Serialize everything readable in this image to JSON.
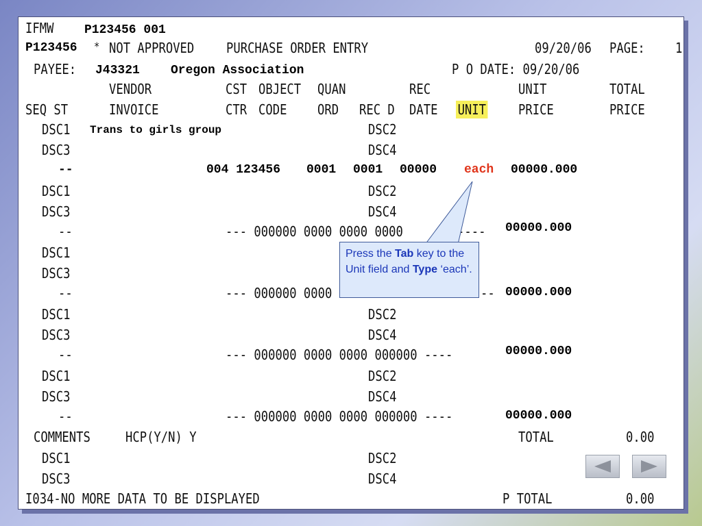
{
  "header": {
    "app_code": "IFMW",
    "session": "P123456 001",
    "user_id": "P123456",
    "star": "*",
    "status": "NOT APPROVED",
    "screen_title": "PURCHASE ORDER ENTRY",
    "date": "09/20/06",
    "page_label": "PAGE:",
    "page_number": "1"
  },
  "payee": {
    "label": "PAYEE:",
    "code": "J43321",
    "name": "Oregon Association",
    "po_date_label": "P O DATE: 09/20/06"
  },
  "columns": {
    "row1": {
      "vendor": "VENDOR",
      "cst": "CST",
      "object": "OBJECT",
      "quan": "QUAN",
      "rec": "REC",
      "unit_price": "UNIT",
      "total_price": "TOTAL"
    },
    "row2": {
      "seq_st": "SEQ ST",
      "invoice": "INVOICE",
      "ctr": "CTR",
      "code": "CODE",
      "ord": "ORD",
      "rec_d": "REC D",
      "date": "DATE",
      "unit": "UNIT",
      "price": "PRICE",
      "price2": "PRICE"
    }
  },
  "lines": [
    {
      "dsc1": "DSC1",
      "dsc1_text": "Trans to girls group",
      "dsc2": "DSC2",
      "dsc3": "DSC3",
      "dsc4": "DSC4",
      "seq": "--",
      "cst_obj": "004 123456",
      "quan": "0001",
      "rec": "0001",
      "date": "00000",
      "unit": "each",
      "price": "00000.000"
    },
    {
      "dsc1": "DSC1",
      "dsc2": "DSC2",
      "dsc3": "DSC3",
      "dsc4": "DSC4",
      "seq": "--",
      "data": "--- 000000 0000 0000 0000",
      "unit": "----",
      "price": "00000.000"
    },
    {
      "dsc1": "DSC1",
      "dsc3": "DSC3",
      "seq": "--",
      "data": "--- 000000 0000",
      "unit": "--",
      "price": "00000.000"
    },
    {
      "dsc1": "DSC1",
      "dsc2": "DSC2",
      "dsc3": "DSC3",
      "dsc4": "DSC4",
      "seq": "--",
      "data": "--- 000000 0000 0000 000000 ----",
      "price": "00000.000"
    },
    {
      "dsc1": "DSC1",
      "dsc2": "DSC2",
      "dsc3": "DSC3",
      "dsc4": "DSC4",
      "seq": "--",
      "data": "--- 000000 0000 0000 000000 ----",
      "price": "00000.000"
    }
  ],
  "footer": {
    "comments": "COMMENTS",
    "hcp": "HCP(Y/N) Y",
    "total_label": "TOTAL",
    "total_value": "0.00",
    "dsc1": "DSC1",
    "dsc2": "DSC2",
    "dsc3": "DSC3",
    "dsc4": "DSC4",
    "message": "I034-NO MORE DATA TO BE DISPLAYED",
    "p_total_label": "P TOTAL",
    "p_total_value": "0.00"
  },
  "callout": {
    "part1": "Press the ",
    "tab": "Tab",
    "part2": " key to the Unit field and ",
    "type": "Type",
    "part3": " ‘each’."
  },
  "nav": {
    "prev_icon": "left-triangle-icon",
    "next_icon": "right-triangle-icon"
  },
  "colors": {
    "highlight": "#f6ef5a",
    "entered_value": "#e0341a",
    "callout_text": "#1a36b8"
  }
}
